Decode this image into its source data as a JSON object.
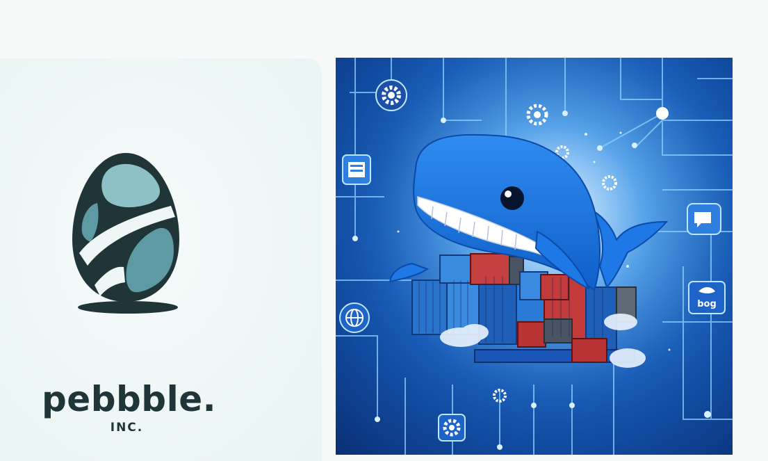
{
  "logo_card": {
    "brand_name": "pebbble.",
    "brand_suffix": "INC."
  },
  "art_card": {
    "tag_label": "bog"
  },
  "colors": {
    "page_background": "#f7f9f9",
    "logo_card_background": "#eef7f6",
    "logo_dark": "#1f3538",
    "logo_teal": "#5e9aa4",
    "logo_light_teal": "#8ec0c8",
    "art_blue": "#155bb8",
    "whale_blue": "#1e78e6"
  },
  "icons": [
    "gear-icon",
    "document-icon",
    "globe-icon",
    "chat-icon",
    "whale-icon",
    "shipping-container-icon"
  ]
}
